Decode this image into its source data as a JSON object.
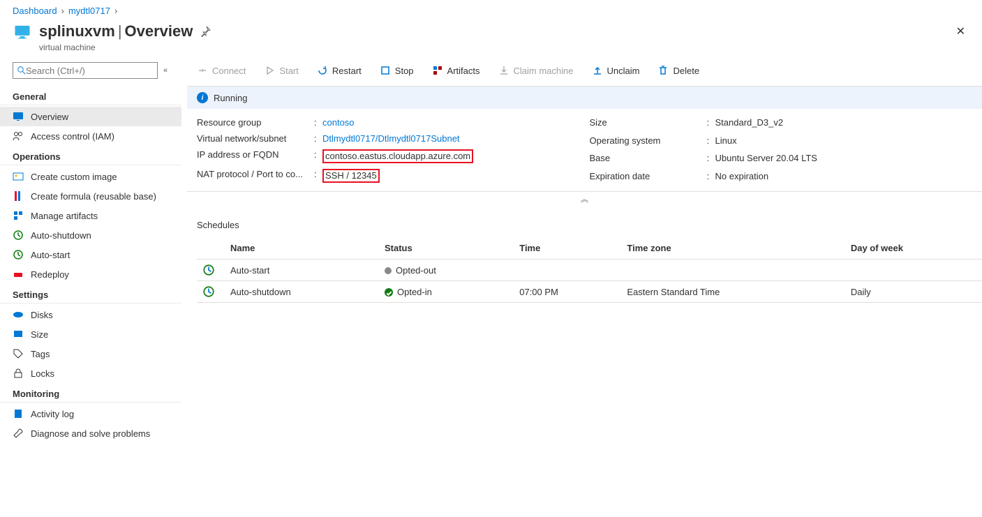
{
  "breadcrumb": {
    "home": "Dashboard",
    "parent": "mydtl0717"
  },
  "header": {
    "resource_name": "splinuxvm",
    "blade": "Overview",
    "resource_type": "virtual machine",
    "pin_tooltip": "Pin",
    "close_tooltip": "Close"
  },
  "sidebar": {
    "search_placeholder": "Search (Ctrl+/)",
    "sections": {
      "general": {
        "title": "General",
        "items": [
          {
            "label": "Overview"
          },
          {
            "label": "Access control (IAM)"
          }
        ]
      },
      "operations": {
        "title": "Operations",
        "items": [
          {
            "label": "Create custom image"
          },
          {
            "label": "Create formula (reusable base)"
          },
          {
            "label": "Manage artifacts"
          },
          {
            "label": "Auto-shutdown"
          },
          {
            "label": "Auto-start"
          },
          {
            "label": "Redeploy"
          }
        ]
      },
      "settings": {
        "title": "Settings",
        "items": [
          {
            "label": "Disks"
          },
          {
            "label": "Size"
          },
          {
            "label": "Tags"
          },
          {
            "label": "Locks"
          }
        ]
      },
      "monitoring": {
        "title": "Monitoring",
        "items": [
          {
            "label": "Activity log"
          },
          {
            "label": "Diagnose and solve problems"
          }
        ]
      }
    }
  },
  "toolbar": {
    "connect": "Connect",
    "start": "Start",
    "restart": "Restart",
    "stop": "Stop",
    "artifacts": "Artifacts",
    "claim": "Claim machine",
    "unclaim": "Unclaim",
    "delete": "Delete"
  },
  "status": {
    "text": "Running"
  },
  "properties": {
    "left": {
      "resource_group": {
        "label": "Resource group",
        "value": "contoso"
      },
      "vnet": {
        "label": "Virtual network/subnet",
        "value": "Dtlmydtl0717/Dtlmydtl0717Subnet"
      },
      "ip": {
        "label": "IP address or FQDN",
        "value": "contoso.eastus.cloudapp.azure.com"
      },
      "nat": {
        "label": "NAT protocol / Port to co...",
        "value": "SSH / 12345"
      }
    },
    "right": {
      "size": {
        "label": "Size",
        "value": "Standard_D3_v2"
      },
      "os": {
        "label": "Operating system",
        "value": "Linux"
      },
      "base": {
        "label": "Base",
        "value": "Ubuntu Server 20.04 LTS"
      },
      "expiration": {
        "label": "Expiration date",
        "value": "No expiration"
      }
    }
  },
  "schedules": {
    "title": "Schedules",
    "columns": {
      "name": "Name",
      "status": "Status",
      "time": "Time",
      "zone": "Time zone",
      "dow": "Day of week"
    },
    "rows": [
      {
        "name": "Auto-start",
        "status": "Opted-out",
        "time": "",
        "zone": "",
        "dow": ""
      },
      {
        "name": "Auto-shutdown",
        "status": "Opted-in",
        "time": "07:00 PM",
        "zone": "Eastern Standard Time",
        "dow": "Daily"
      }
    ]
  }
}
